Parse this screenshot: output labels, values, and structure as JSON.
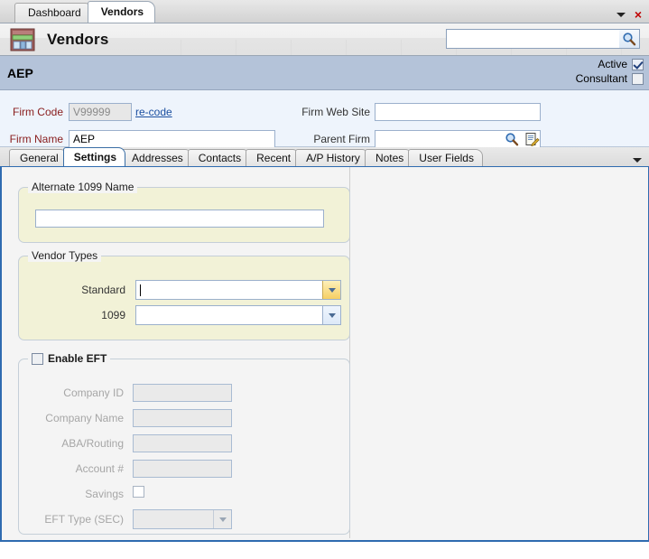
{
  "window": {
    "tabs": [
      {
        "label": "Dashboard",
        "active": false
      },
      {
        "label": "Vendors",
        "active": true
      }
    ],
    "menu_caret_icon": "caret-down-icon",
    "close_icon": "close-x-icon",
    "close_label": "×"
  },
  "module": {
    "icon": "storefront-icon",
    "title": "Vendors",
    "search": {
      "value": "",
      "placeholder": "",
      "button_icon": "magnifier-icon"
    }
  },
  "record": {
    "title": "AEP",
    "flags": [
      {
        "label": "Active",
        "checked": true
      },
      {
        "label": "Consultant",
        "checked": false
      }
    ]
  },
  "firm": {
    "firm_code_label": "Firm Code",
    "firm_code_value": "V99999",
    "recode_link": "re-code",
    "firm_name_label": "Firm Name",
    "firm_name_value": "AEP",
    "web_site_label": "Firm Web Site",
    "web_site_value": "",
    "parent_firm_label": "Parent Firm",
    "parent_firm_value": "",
    "parent_search_icon": "magnifier-icon",
    "parent_edit_icon": "document-edit-icon"
  },
  "inner_tabs": {
    "items": [
      {
        "label": "General",
        "active": false
      },
      {
        "label": "Settings",
        "active": true
      },
      {
        "label": "Addresses",
        "active": false
      },
      {
        "label": "Contacts",
        "active": false
      },
      {
        "label": "Recent",
        "active": false
      },
      {
        "label": "A/P History",
        "active": false
      },
      {
        "label": "Notes",
        "active": false
      },
      {
        "label": "User Fields",
        "active": false
      }
    ],
    "overflow_icon": "caret-down-icon"
  },
  "settings": {
    "alt1099": {
      "legend": "Alternate 1099 Name",
      "value": ""
    },
    "vendor_types": {
      "legend": "Vendor Types",
      "standard_label": "Standard",
      "standard_value": "",
      "standard_arrow_icon": "caret-down-icon",
      "v1099_label": "1099",
      "v1099_value": "",
      "v1099_arrow_icon": "caret-down-icon"
    },
    "eft": {
      "legend": "Enable EFT",
      "enabled": false,
      "fields": [
        {
          "label": "Company ID",
          "value": "",
          "type": "text"
        },
        {
          "label": "Company Name",
          "value": "",
          "type": "text"
        },
        {
          "label": "ABA/Routing",
          "value": "",
          "type": "text"
        },
        {
          "label": "Account #",
          "value": "",
          "type": "text"
        },
        {
          "label": "Savings",
          "value": "",
          "type": "checkbox"
        },
        {
          "label": "EFT Type (SEC)",
          "value": "",
          "type": "combo"
        }
      ]
    }
  },
  "colors": {
    "record_bar": "#b4c3d9",
    "fieldset_bg": "#f2f2d7",
    "label_red": "#8a2020",
    "link_blue": "#1b4fa0",
    "accent_border": "#2f6bb0",
    "focus_gold": "#f6cf63"
  }
}
